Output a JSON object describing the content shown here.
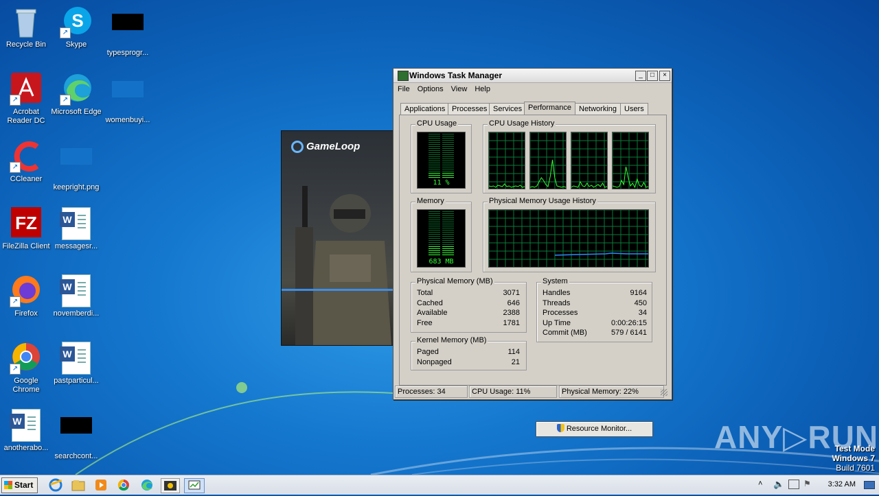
{
  "desktop": {
    "icons": [
      {
        "label": "Recycle Bin",
        "icon": "recycle-bin-icon"
      },
      {
        "label": "Skype",
        "icon": "skype-icon"
      },
      {
        "label": "typesprogr...",
        "icon": "black-image-icon"
      },
      {
        "label": "Acrobat Reader DC",
        "icon": "acrobat-icon"
      },
      {
        "label": "Microsoft Edge",
        "icon": "edge-icon"
      },
      {
        "label": "womenbuyi...",
        "icon": "blank-image-icon"
      },
      {
        "label": "CCleaner",
        "icon": "ccleaner-icon"
      },
      {
        "label": "keepright.png",
        "icon": "png-image-icon"
      },
      {
        "label": "FileZilla Client",
        "icon": "filezilla-icon"
      },
      {
        "label": "messagesr...",
        "icon": "word-doc-icon"
      },
      {
        "label": "Firefox",
        "icon": "firefox-icon"
      },
      {
        "label": "novemberdi...",
        "icon": "word-doc-icon"
      },
      {
        "label": "Google Chrome",
        "icon": "chrome-icon"
      },
      {
        "label": "pastparticul...",
        "icon": "word-doc-icon"
      },
      {
        "label": "anotherabo...",
        "icon": "word-doc-icon"
      },
      {
        "label": "searchcont...",
        "icon": "black-image-icon"
      }
    ]
  },
  "gameloop": {
    "logo_text": "GameLoop"
  },
  "task_manager": {
    "title": "Windows Task Manager",
    "window_buttons": [
      "_",
      "□",
      "×"
    ],
    "menu": [
      "File",
      "Options",
      "View",
      "Help"
    ],
    "tabs": [
      "Applications",
      "Processes",
      "Services",
      "Performance",
      "Networking",
      "Users"
    ],
    "active_tab": "Performance",
    "cpu_usage": {
      "label": "CPU Usage",
      "value": "11 %",
      "percent": 11
    },
    "cpu_history": {
      "label": "CPU Usage History"
    },
    "memory": {
      "label": "Memory",
      "value": "683 MB"
    },
    "memory_history": {
      "label": "Physical Memory Usage History"
    },
    "physical_memory": {
      "label": "Physical Memory (MB)",
      "rows": [
        {
          "k": "Total",
          "v": "3071"
        },
        {
          "k": "Cached",
          "v": "646"
        },
        {
          "k": "Available",
          "v": "2388"
        },
        {
          "k": "Free",
          "v": "1781"
        }
      ]
    },
    "kernel_memory": {
      "label": "Kernel Memory (MB)",
      "rows": [
        {
          "k": "Paged",
          "v": "114"
        },
        {
          "k": "Nonpaged",
          "v": "21"
        }
      ]
    },
    "system": {
      "label": "System",
      "rows": [
        {
          "k": "Handles",
          "v": "9164"
        },
        {
          "k": "Threads",
          "v": "450"
        },
        {
          "k": "Processes",
          "v": "34"
        },
        {
          "k": "Up Time",
          "v": "0:00:26:15"
        },
        {
          "k": "Commit (MB)",
          "v": "579 / 6141"
        }
      ]
    },
    "resource_monitor_button": "Resource Monitor...",
    "status": {
      "processes": "Processes: 34",
      "cpu": "CPU Usage: 11%",
      "memory": "Physical Memory: 22%"
    }
  },
  "watermark": {
    "brand": "ANY▷RUN"
  },
  "test_mode": {
    "line1": "Test Mode",
    "line2": "Windows 7",
    "line3": "Build 7601"
  },
  "taskbar": {
    "start_label": "Start",
    "pinned": [
      "ie-icon",
      "explorer-icon",
      "media-player-icon",
      "chrome-icon",
      "edge-icon",
      "gameloop-icon",
      "task-manager-icon"
    ],
    "clock": "3:32 AM"
  }
}
